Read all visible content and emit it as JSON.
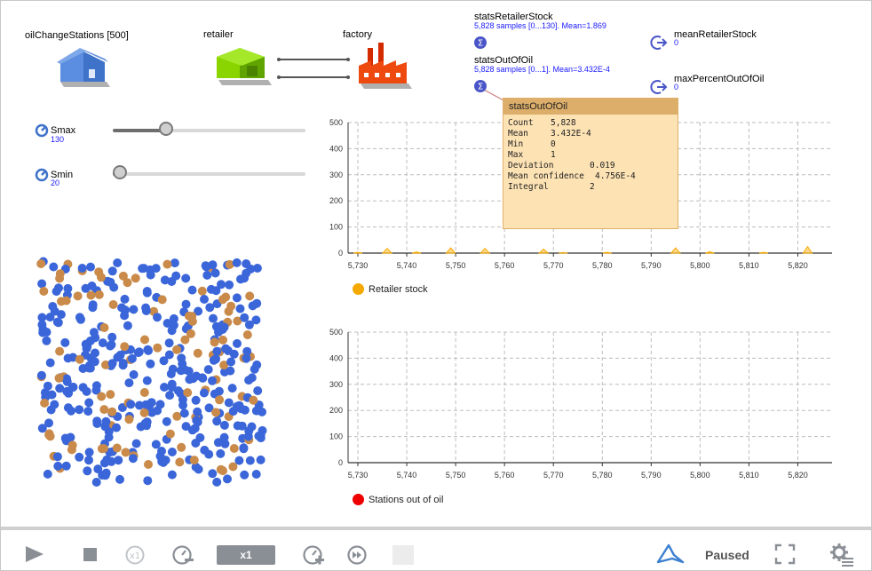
{
  "model": {
    "oilChangeStations": "oilChangeStations [500]",
    "retailer": "retailer",
    "factory": "factory",
    "statsRetailerStock": {
      "name": "statsRetailerStock",
      "summary": "5,828 samples [0...130]. Mean=1.869"
    },
    "statsOutOfOil": {
      "name": "statsOutOfOil",
      "summary": "5,828 samples [0...1]. Mean=3.432E-4"
    },
    "meanRetailerStock": {
      "name": "meanRetailerStock",
      "value": "0"
    },
    "maxPercentOutOfOil": {
      "name": "maxPercentOutOfOil",
      "value": "0"
    }
  },
  "parameters": {
    "smax": {
      "name": "Smax",
      "value": "130",
      "fraction": 0.26
    },
    "smin": {
      "name": "Smin",
      "value": "20",
      "fraction": 0.0
    }
  },
  "tooltip": {
    "title": "statsOutOfOil",
    "rows": [
      {
        "label": "Count",
        "value": "5,828"
      },
      {
        "label": "Mean",
        "value": "3.432E-4"
      },
      {
        "label": "Min",
        "value": "0"
      },
      {
        "label": "Max",
        "value": "1"
      },
      {
        "label": "Deviation",
        "value": "0.019"
      },
      {
        "label": "Mean confidence",
        "value": "4.756E-4"
      },
      {
        "label": "Integral",
        "value": "2"
      }
    ]
  },
  "chart_data": [
    {
      "type": "area",
      "x": [
        5730,
        5736,
        5742,
        5749,
        5756,
        5768,
        5772,
        5781,
        5795,
        5802,
        5813,
        5822
      ],
      "series": [
        {
          "name": "Retailer stock",
          "values": [
            3,
            18,
            4,
            20,
            18,
            15,
            2,
            3,
            20,
            5,
            3,
            25
          ],
          "color": "#f5a800"
        }
      ],
      "xlim": [
        5728,
        5827
      ],
      "ylim": [
        0,
        500
      ],
      "xticks": [
        "5,730",
        "5,740",
        "5,750",
        "5,760",
        "5,770",
        "5,780",
        "5,790",
        "5,800",
        "5,810",
        "5,820"
      ],
      "yticks": [
        "0",
        "100",
        "200",
        "300",
        "400",
        "500"
      ],
      "grid": true,
      "legend": "bottom-left"
    },
    {
      "type": "area",
      "x": [
        5730,
        5822
      ],
      "series": [
        {
          "name": "Stations out of oil",
          "values": [
            0,
            0
          ],
          "color": "#ee0000"
        }
      ],
      "xlim": [
        5728,
        5827
      ],
      "ylim": [
        0,
        500
      ],
      "xticks": [
        "5,730",
        "5,740",
        "5,750",
        "5,760",
        "5,770",
        "5,780",
        "5,790",
        "5,800",
        "5,810",
        "5,820"
      ],
      "yticks": [
        "0",
        "100",
        "200",
        "300",
        "400",
        "500"
      ],
      "grid": true,
      "legend": "bottom-left"
    }
  ],
  "colors": {
    "station_ok": "#3b66d9",
    "station_warn": "#c98a4a",
    "accent": "#1a1aff"
  },
  "toolbar": {
    "speed": "x1",
    "status": "Paused",
    "icons": [
      "play-icon",
      "stop-icon",
      "step-icon",
      "slow-down-icon",
      "speed-up-icon",
      "fast-forward-icon",
      "anylogic-logo-icon",
      "fullscreen-icon",
      "settings-icon"
    ]
  }
}
